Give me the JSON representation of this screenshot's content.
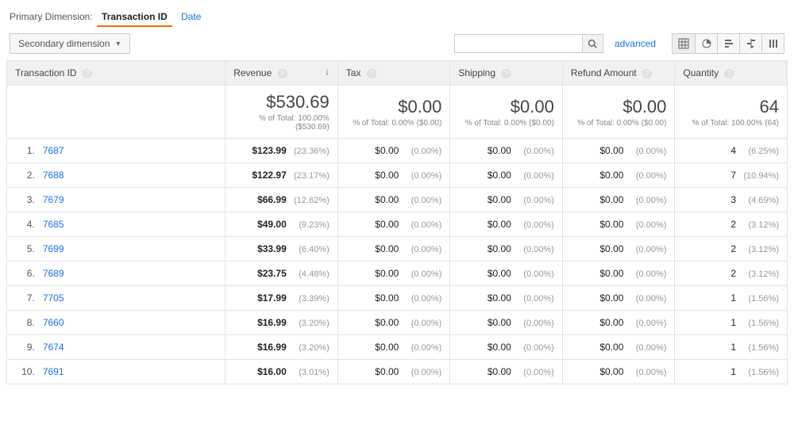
{
  "primary_dimension": {
    "label": "Primary Dimension:",
    "active": "Transaction ID",
    "other": "Date"
  },
  "secondary_dimension_btn": "Secondary dimension",
  "search": {
    "placeholder": ""
  },
  "advanced_link": "advanced",
  "columns": {
    "transaction_id": "Transaction ID",
    "revenue": "Revenue",
    "tax": "Tax",
    "shipping": "Shipping",
    "refund": "Refund Amount",
    "quantity": "Quantity"
  },
  "summary": {
    "revenue": {
      "big": "$530.69",
      "sub": "% of Total: 100.00% ($530.69)"
    },
    "tax": {
      "big": "$0.00",
      "sub": "% of Total: 0.00% ($0.00)"
    },
    "shipping": {
      "big": "$0.00",
      "sub": "% of Total: 0.00% ($0.00)"
    },
    "refund": {
      "big": "$0.00",
      "sub": "% of Total: 0.00% ($0.00)"
    },
    "quantity": {
      "big": "64",
      "sub": "% of Total: 100.00% (64)"
    }
  },
  "rows": [
    {
      "n": "1.",
      "id": "7687",
      "rev": "$123.99",
      "rev_pct": "(23.36%)",
      "tax": "$0.00",
      "tax_pct": "(0.00%)",
      "ship": "$0.00",
      "ship_pct": "(0.00%)",
      "ref": "$0.00",
      "ref_pct": "(0.00%)",
      "qty": "4",
      "qty_pct": "(6.25%)"
    },
    {
      "n": "2.",
      "id": "7688",
      "rev": "$122.97",
      "rev_pct": "(23.17%)",
      "tax": "$0.00",
      "tax_pct": "(0.00%)",
      "ship": "$0.00",
      "ship_pct": "(0.00%)",
      "ref": "$0.00",
      "ref_pct": "(0.00%)",
      "qty": "7",
      "qty_pct": "(10.94%)"
    },
    {
      "n": "3.",
      "id": "7679",
      "rev": "$66.99",
      "rev_pct": "(12.62%)",
      "tax": "$0.00",
      "tax_pct": "(0.00%)",
      "ship": "$0.00",
      "ship_pct": "(0.00%)",
      "ref": "$0.00",
      "ref_pct": "(0.00%)",
      "qty": "3",
      "qty_pct": "(4.69%)"
    },
    {
      "n": "4.",
      "id": "7685",
      "rev": "$49.00",
      "rev_pct": "(9.23%)",
      "tax": "$0.00",
      "tax_pct": "(0.00%)",
      "ship": "$0.00",
      "ship_pct": "(0.00%)",
      "ref": "$0.00",
      "ref_pct": "(0.00%)",
      "qty": "2",
      "qty_pct": "(3.12%)"
    },
    {
      "n": "5.",
      "id": "7699",
      "rev": "$33.99",
      "rev_pct": "(6.40%)",
      "tax": "$0.00",
      "tax_pct": "(0.00%)",
      "ship": "$0.00",
      "ship_pct": "(0.00%)",
      "ref": "$0.00",
      "ref_pct": "(0.00%)",
      "qty": "2",
      "qty_pct": "(3.12%)"
    },
    {
      "n": "6.",
      "id": "7689",
      "rev": "$23.75",
      "rev_pct": "(4.48%)",
      "tax": "$0.00",
      "tax_pct": "(0.00%)",
      "ship": "$0.00",
      "ship_pct": "(0.00%)",
      "ref": "$0.00",
      "ref_pct": "(0.00%)",
      "qty": "2",
      "qty_pct": "(3.12%)"
    },
    {
      "n": "7.",
      "id": "7705",
      "rev": "$17.99",
      "rev_pct": "(3.39%)",
      "tax": "$0.00",
      "tax_pct": "(0.00%)",
      "ship": "$0.00",
      "ship_pct": "(0.00%)",
      "ref": "$0.00",
      "ref_pct": "(0.00%)",
      "qty": "1",
      "qty_pct": "(1.56%)"
    },
    {
      "n": "8.",
      "id": "7660",
      "rev": "$16.99",
      "rev_pct": "(3.20%)",
      "tax": "$0.00",
      "tax_pct": "(0.00%)",
      "ship": "$0.00",
      "ship_pct": "(0.00%)",
      "ref": "$0.00",
      "ref_pct": "(0.00%)",
      "qty": "1",
      "qty_pct": "(1.56%)"
    },
    {
      "n": "9.",
      "id": "7674",
      "rev": "$16.99",
      "rev_pct": "(3.20%)",
      "tax": "$0.00",
      "tax_pct": "(0.00%)",
      "ship": "$0.00",
      "ship_pct": "(0.00%)",
      "ref": "$0.00",
      "ref_pct": "(0.00%)",
      "qty": "1",
      "qty_pct": "(1.56%)"
    },
    {
      "n": "10.",
      "id": "7691",
      "rev": "$16.00",
      "rev_pct": "(3.01%)",
      "tax": "$0.00",
      "tax_pct": "(0.00%)",
      "ship": "$0.00",
      "ship_pct": "(0.00%)",
      "ref": "$0.00",
      "ref_pct": "(0.00%)",
      "qty": "1",
      "qty_pct": "(1.56%)"
    }
  ]
}
